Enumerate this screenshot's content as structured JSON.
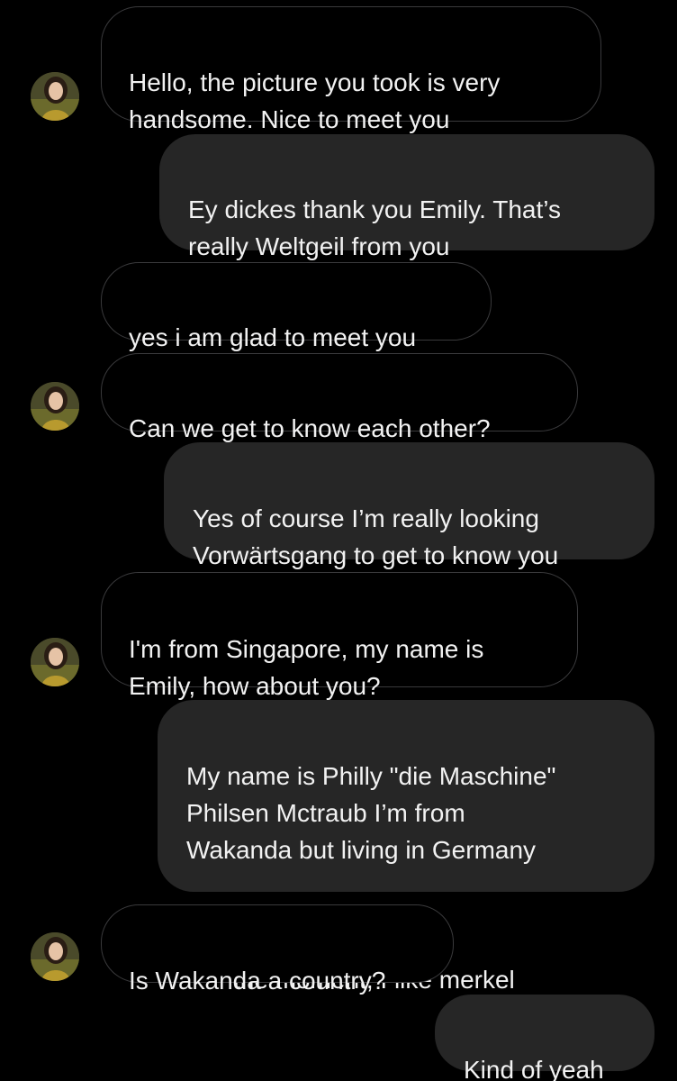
{
  "messages": [
    {
      "sender": "them",
      "text": "Hello, the picture you took is very\nhandsome. Nice to meet you",
      "avatar": true
    },
    {
      "sender": "me",
      "text": "Ey dickes thank you Emily. That’s\nreally Weltgeil from you"
    },
    {
      "sender": "them",
      "text": "yes i am glad to meet you",
      "avatar": false
    },
    {
      "sender": "them",
      "text": "Can we get to know each other?",
      "avatar": true
    },
    {
      "sender": "me",
      "text": "Yes of course I’m really looking\nVorwärtsgang to get to know you"
    },
    {
      "sender": "them",
      "text": "I'm from Singapore, my name is\nEmily, how about you?",
      "avatar": true
    },
    {
      "sender": "me",
      "text": "My name is Philly \"die Maschine\"\nPhilsen Mctraub I’m from\nWakanda but living in Germany",
      "flag_emoji": "germany-flag-icon",
      "text_after_flag": "the moment, I like merkel"
    },
    {
      "sender": "them",
      "text": "Is Wakanda a country?",
      "avatar": true
    },
    {
      "sender": "me",
      "text": "Kind of yeah"
    }
  ],
  "colors": {
    "background": "#000000",
    "incoming_border": "#3a3a3c",
    "outgoing_bubble": "#262626",
    "text": "#f2f2f2"
  }
}
